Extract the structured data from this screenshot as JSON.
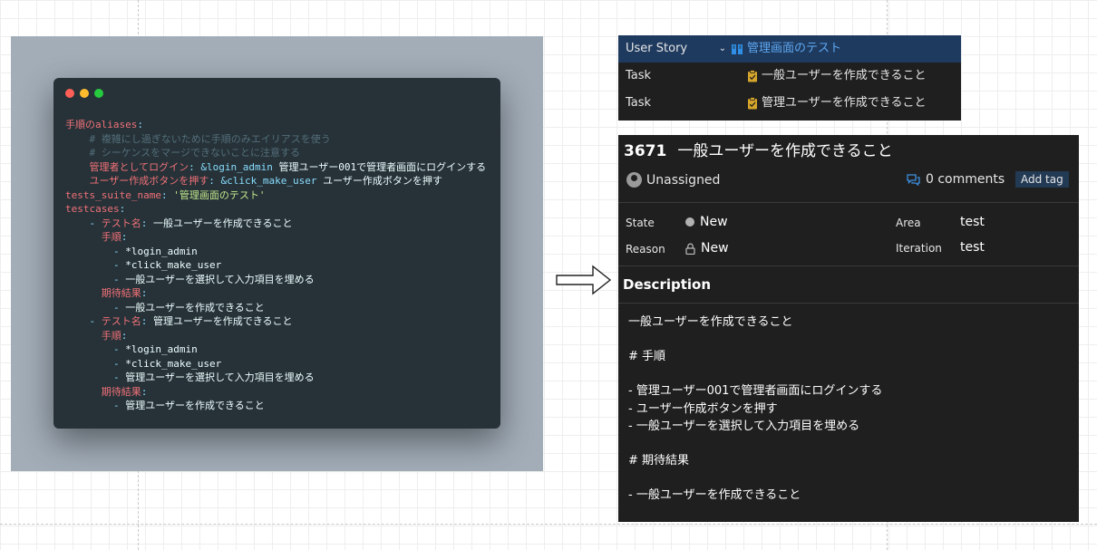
{
  "colors": {
    "accent_blue": "#5ea8f2",
    "dot_red": "#ff5f56",
    "dot_yellow": "#ffbd2e",
    "dot_green": "#27c93f",
    "task_icon": "#d4a52a"
  },
  "code": {
    "lines": [
      [
        {
          "t": "手順のaliases",
          "c": "k"
        },
        {
          "t": ":",
          "c": "p"
        }
      ],
      [
        {
          "t": "    # 複雑にし過ぎないために手順のみエイリアスを使う",
          "c": "c"
        }
      ],
      [
        {
          "t": "    # シーケンスをマージできないことに注意する",
          "c": "c"
        }
      ],
      [
        {
          "t": "    管理者としてログイン",
          "c": "k"
        },
        {
          "t": ": ",
          "c": "p"
        },
        {
          "t": "&login_admin",
          "c": "a"
        },
        {
          "t": " 管理ユーザー001で管理者画面にログインする",
          "c": "v"
        }
      ],
      [
        {
          "t": "    ユーザー作成ボタンを押す",
          "c": "k"
        },
        {
          "t": ": ",
          "c": "p"
        },
        {
          "t": "&click_make_user",
          "c": "a"
        },
        {
          "t": " ユーザー作成ボタンを押す",
          "c": "v"
        }
      ],
      [
        {
          "t": "tests_suite_name",
          "c": "k"
        },
        {
          "t": ": ",
          "c": "p"
        },
        {
          "t": "'管理画面のテスト'",
          "c": "s"
        }
      ],
      [
        {
          "t": "testcases",
          "c": "k"
        },
        {
          "t": ":",
          "c": "p"
        }
      ],
      [
        {
          "t": "    - ",
          "c": "p"
        },
        {
          "t": "テスト名",
          "c": "k"
        },
        {
          "t": ": ",
          "c": "p"
        },
        {
          "t": "一般ユーザーを作成できること",
          "c": "v"
        }
      ],
      [
        {
          "t": "      手順",
          "c": "k"
        },
        {
          "t": ":",
          "c": "p"
        }
      ],
      [
        {
          "t": "        - ",
          "c": "p"
        },
        {
          "t": "*login_admin",
          "c": "v"
        }
      ],
      [
        {
          "t": "        - ",
          "c": "p"
        },
        {
          "t": "*click_make_user",
          "c": "v"
        }
      ],
      [
        {
          "t": "        - ",
          "c": "p"
        },
        {
          "t": "一般ユーザーを選択して入力項目を埋める",
          "c": "v"
        }
      ],
      [
        {
          "t": "      期待結果",
          "c": "k"
        },
        {
          "t": ":",
          "c": "p"
        }
      ],
      [
        {
          "t": "        - ",
          "c": "p"
        },
        {
          "t": "一般ユーザーを作成できること",
          "c": "v"
        }
      ],
      [
        {
          "t": "    - ",
          "c": "p"
        },
        {
          "t": "テスト名",
          "c": "k"
        },
        {
          "t": ": ",
          "c": "p"
        },
        {
          "t": "管理ユーザーを作成できること",
          "c": "v"
        }
      ],
      [
        {
          "t": "      手順",
          "c": "k"
        },
        {
          "t": ":",
          "c": "p"
        }
      ],
      [
        {
          "t": "        - ",
          "c": "p"
        },
        {
          "t": "*login_admin",
          "c": "v"
        }
      ],
      [
        {
          "t": "        - ",
          "c": "p"
        },
        {
          "t": "*click_make_user",
          "c": "v"
        }
      ],
      [
        {
          "t": "        - ",
          "c": "p"
        },
        {
          "t": "管理ユーザーを選択して入力項目を埋める",
          "c": "v"
        }
      ],
      [
        {
          "t": "      期待結果",
          "c": "k"
        },
        {
          "t": ":",
          "c": "p"
        }
      ],
      [
        {
          "t": "        - ",
          "c": "p"
        },
        {
          "t": "管理ユーザーを作成できること",
          "c": "v"
        }
      ]
    ]
  },
  "tree": {
    "rows": [
      {
        "type": "User Story",
        "title": "管理画面のテスト"
      },
      {
        "type": "Task",
        "title": "一般ユーザーを作成できること"
      },
      {
        "type": "Task",
        "title": "管理ユーザーを作成できること"
      }
    ]
  },
  "workitem": {
    "id": "3671",
    "title": "一般ユーザーを作成できること",
    "assignee": "Unassigned",
    "comments": "0 comments",
    "add_tag": "Add tag",
    "fields": {
      "state_label": "State",
      "state_value": "New",
      "reason_label": "Reason",
      "reason_value": "New",
      "area_label": "Area",
      "area_value": "test",
      "iteration_label": "Iteration",
      "iteration_value": "test"
    },
    "description_heading": "Description",
    "description": {
      "summary": "一般ユーザーを作成できること",
      "steps_heading": "# 手順",
      "steps": [
        "- 管理ユーザー001で管理者画面にログインする",
        "- ユーザー作成ボタンを押す",
        "- 一般ユーザーを選択して入力項目を埋める"
      ],
      "expected_heading": "# 期待結果",
      "expected": [
        "- 一般ユーザーを作成できること"
      ]
    }
  }
}
